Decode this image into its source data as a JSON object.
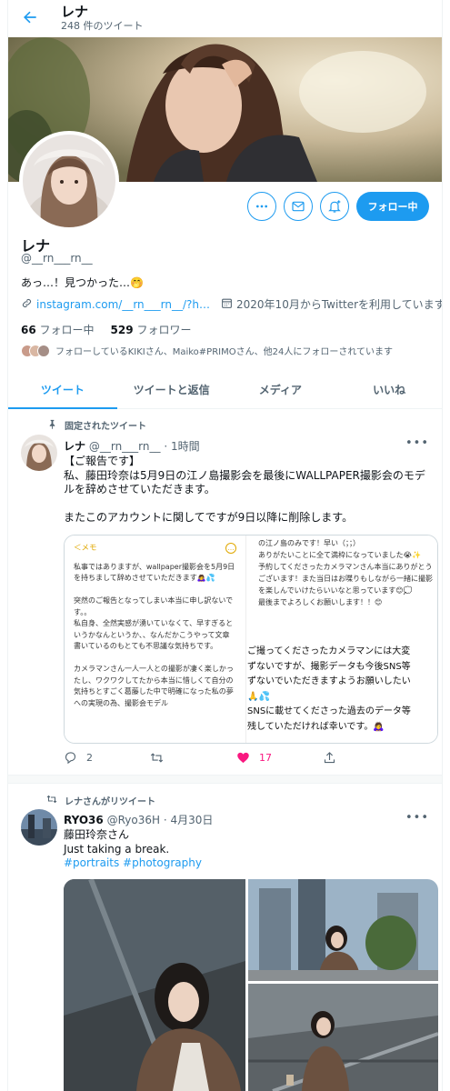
{
  "header": {
    "back_icon": "arrow-left-icon",
    "name": "レナ",
    "tweet_count": "248 件のツイート"
  },
  "profile": {
    "name": "レナ",
    "handle": "@__rn___rn__",
    "bio": "あっ…！見つかった…🤭",
    "link": "instagram.com/__rn___rn__/?h…",
    "joined": "2020年10月からTwitterを利用しています",
    "following_count": "66",
    "following_label": "フォロー中",
    "followers_count": "529",
    "followers_label": "フォロワー",
    "followed_by": "フォローしているKIKIさん、Maiko#PRIMOさん、他24人にフォローされています",
    "follow_button": "フォロー中"
  },
  "tabs": [
    {
      "label": "ツイート"
    },
    {
      "label": "ツイートと返信"
    },
    {
      "label": "メディア"
    },
    {
      "label": "いいね"
    }
  ],
  "tweet1": {
    "context": "固定されたツイート",
    "name": "レナ",
    "handle": "@__rn___rn__",
    "time": "· 1時間",
    "text": "【ご報告です】\n私、藤田玲奈は5月9日の江ノ島撮影会を最後にWALLPAPER撮影会のモデルを辞めさせていただきます。\n\nまたこのアカウントに関してですが9日以降に削除します。",
    "memo_header": "＜メモ",
    "memo_left": "私事ではありますが、wallpaper撮影会を5月9日を持ちまして辞めさせていただきます🙇‍♀️💦\n\n突然のご報告となってしまい本当に申し訳ないです。。\n私自身、全然実感が湧いていなくて、早すぎるというかなんというか、、なんだかこうやって文章書いているのもとても不思議な気持ちです。\n\nカメラマンさん一人一人との撮影が凄く楽しかったし、ワクワクしてたから本当に惜しくて自分の気持ちとすごく葛藤した中で明確になった私の夢への実現の為、撮影会モデル",
    "memo_right_top": "の江ノ島のみです！早い（；；）\nありがたいことに全て満枠になっていました😭✨\n予約してくださったカメラマンさん本当にありがとうございます！また当日はお喋りもしながら一緒に撮影を楽しんでいけたらいいなと思っています😊💭\n最後までよろしくお願いします！！😊",
    "memo_right_bottom": "ご撮ってくださったカメラマンには大変\nずないですが、撮影データも今後SNS等\nずないでいただきますようお願いしたい\n🙏💦\nSNSに載せてくださった過去のデータ等\n残していただければ幸いです。🙇‍♀️",
    "replies": "2",
    "retweets": "",
    "likes": "17"
  },
  "tweet2": {
    "context": "レナさんがリツイート",
    "name": "RYO36",
    "handle": "@Ryo36H",
    "time": "· 4月30日",
    "text": "藤田玲奈さん\nJust taking a break.",
    "hashtags": "#portraits #photography"
  }
}
